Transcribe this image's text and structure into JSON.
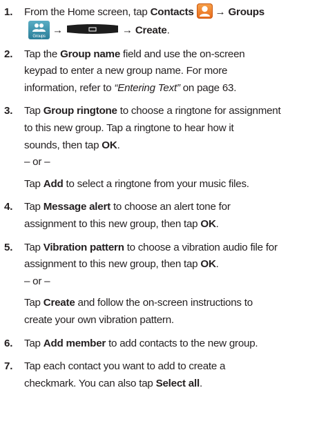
{
  "steps": [
    {
      "num": "1.",
      "t_home": "From the Home screen, tap",
      "b_contacts": "Contacts",
      "arrow1": "→",
      "b_groups": "Groups",
      "groups_icon_label": "Groups",
      "arrow2": "→",
      "arrow3": "→",
      "b_create": "Create",
      "end": "."
    },
    {
      "num": "2.",
      "t1": "Tap the",
      "b1": "Group name",
      "t2": "field and use the on-screen",
      "line2": "keypad to enter a new group name. For more",
      "t3": "information, refer to",
      "ref": "“Entering Text”",
      "t4": "on page 63."
    },
    {
      "num": "3.",
      "t1": "Tap",
      "b1": "Group ringtone",
      "t2": "to choose a ringtone for assignment",
      "line2": "to this new group. Tap a ringtone to hear how it",
      "t3": "sounds, then tap",
      "b2": "OK",
      "end": ".",
      "or": "– or –",
      "alt_t1": "Tap",
      "alt_b1": "Add",
      "alt_t2": "to select a ringtone from your music files."
    },
    {
      "num": "4.",
      "t1": "Tap",
      "b1": "Message alert",
      "t2": "to choose an alert tone for",
      "t3": "assignment to this new group, then tap",
      "b2": "OK",
      "end": "."
    },
    {
      "num": "5.",
      "t1": "Tap",
      "b1": "Vibration pattern",
      "t2": "to choose a vibration audio file for",
      "t3": "assignment to this new group, then tap",
      "b2": "OK",
      "end": ".",
      "or": "– or –",
      "alt_t1": "Tap",
      "alt_b1": "Create",
      "alt_t2": "and follow the on-screen instructions to",
      "alt_line2": "create your own vibration pattern."
    },
    {
      "num": "6.",
      "t1": "Tap",
      "b1": "Add member",
      "t2": "to add contacts to the new group."
    },
    {
      "num": "7.",
      "line1": "Tap each contact you want to add to create a",
      "t1": "checkmark. You can also tap",
      "b1": "Select all",
      "end": "."
    }
  ],
  "icons": {
    "contacts": "contacts-icon",
    "groups": "groups-icon",
    "menu": "menu-key-icon"
  },
  "colors": {
    "text": "#231f20",
    "contacts_icon": "#f08a2c",
    "groups_icon": "#3b91ad",
    "menu_key": "#1d1d1d"
  }
}
